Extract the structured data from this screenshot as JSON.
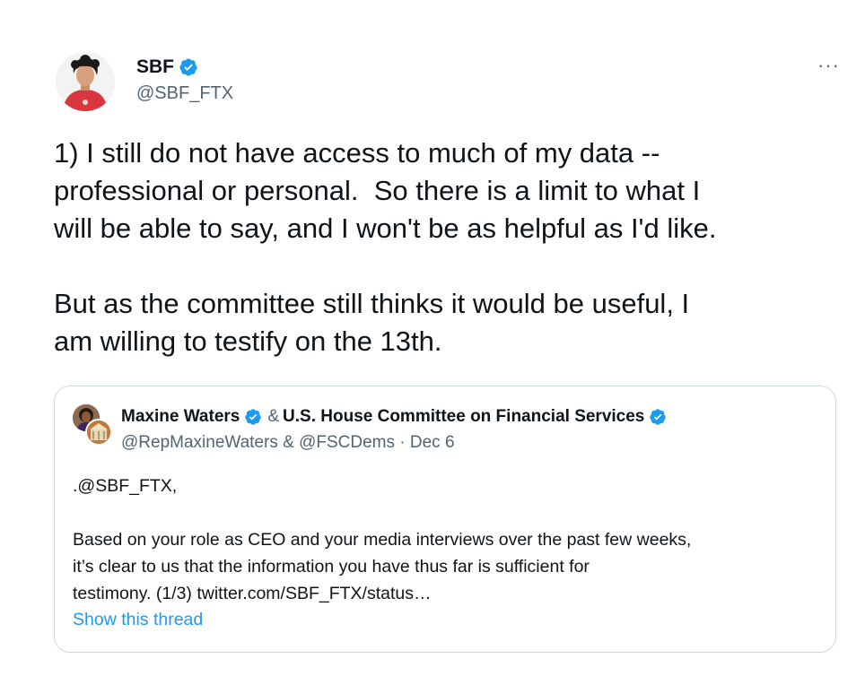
{
  "tweet": {
    "display_name": "SBF",
    "handle": "@SBF_FTX",
    "more_label": "···",
    "paragraph1": "1) I still do not have access to much of my data --\nprofessional or personal.  So there is a limit to what I\nwill be able to say, and I won't be as helpful as I'd like.",
    "paragraph2": "But as the committee still thinks it would be useful, I\nam willing to testify on the 13th."
  },
  "quote": {
    "author1": "Maxine Waters",
    "amp": "&",
    "author2": "U.S. House Committee on Financial Services",
    "handles_line": "@RepMaxineWaters & @FSCDems · Dec 6",
    "line1": ".@SBF_FTX,",
    "body": "Based on your role as CEO and your media interviews over the past few weeks,\nit’s clear to us that the information you have thus far is sufficient for\ntestimony. (1/3) twitter.com/SBF_FTX/status…",
    "show_thread": "Show this thread"
  },
  "colors": {
    "verified": "#1d9bf0",
    "link": "#1d9bf0",
    "secondary_text": "#536471",
    "border": "#cfd9de"
  },
  "icons": {
    "verified": "verified-badge-icon",
    "more": "more-horizontal-icon"
  }
}
